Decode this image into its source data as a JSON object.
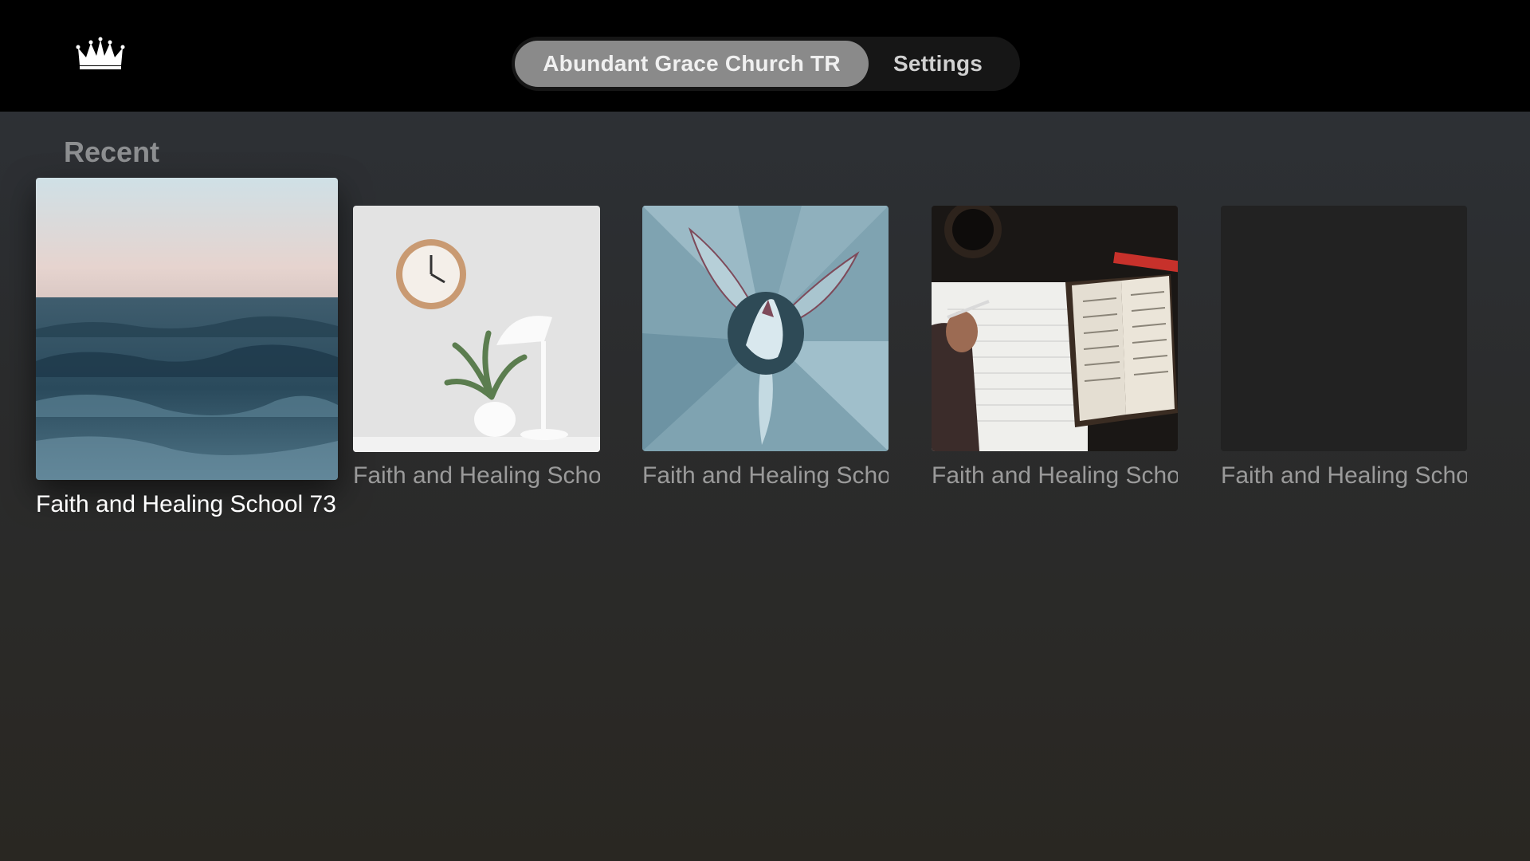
{
  "app": {
    "logo_text": "Abundant Grace Church"
  },
  "tabs": [
    {
      "label": "Abundant Grace Church TR",
      "active": true
    },
    {
      "label": "Settings",
      "active": false
    }
  ],
  "sections": {
    "recent": {
      "title": "Recent",
      "items": [
        {
          "title": "Faith and Healing School 73",
          "image": "ocean-waves"
        },
        {
          "title": "Faith and Healing School",
          "image": "clock-and-plant"
        },
        {
          "title": "Faith and Healing School",
          "image": "succulent"
        },
        {
          "title": "Faith and Healing School",
          "image": "bible-and-notebook"
        },
        {
          "title": "Faith and Healing School",
          "image": "blank"
        }
      ]
    }
  }
}
